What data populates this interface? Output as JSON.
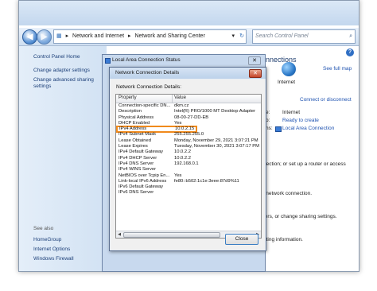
{
  "explorer": {
    "breadcrumb": [
      "Network and Internet",
      "Network and Sharing Center"
    ],
    "search_placeholder": "Search Control Panel",
    "sep": "▸"
  },
  "sidebar": {
    "home": "Control Panel Home",
    "items": [
      "Change adapter settings",
      "Change advanced sharing settings"
    ],
    "see_also": "See also",
    "see_also_items": [
      "HomeGroup",
      "Internet Options",
      "Windows Firewall"
    ]
  },
  "main": {
    "connections_heading": "onnections",
    "see_full_map": "See full map",
    "internet": "Internet",
    "connect_or_disconnect": "Connect or disconnect",
    "access_type_label": "e:",
    "access_type_value": "Internet",
    "homegroup_label": "p:",
    "homegroup_value": "Ready to create",
    "connections_label": "ns:",
    "connections_value": "Local Area Connection",
    "setup_text": "nection; or set up a router or access",
    "network_text": "l network connection.",
    "sharing_text": "ters, or change sharing settings.",
    "options_text": "oting information."
  },
  "status_dialog": {
    "title": "Local Area Connection Status"
  },
  "details_dialog": {
    "title": "Network Connection Details",
    "label": "Network Connection Details:",
    "col_property": "Property",
    "col_value": "Value",
    "rows": [
      {
        "p": "Connection-specific DN...",
        "v": "dkm.cz"
      },
      {
        "p": "Description",
        "v": "Intel(R) PRO/1000 MT Desktop Adapter"
      },
      {
        "p": "Physical Address",
        "v": "08-00-27-DD-EB"
      },
      {
        "p": "DHCP Enabled",
        "v": "Yes"
      },
      {
        "p": "IPv4 Address",
        "v": "10.0.2.15"
      },
      {
        "p": "IPv4 Subnet Mask",
        "v": "255.255.255.0"
      },
      {
        "p": "Lease Obtained",
        "v": "Monday, November 29, 2021 3:07:21 PM"
      },
      {
        "p": "Lease Expires",
        "v": "Tuesday, November 30, 2021 3:07:17 PM"
      },
      {
        "p": "IPv4 Default Gateway",
        "v": "10.0.2.2"
      },
      {
        "p": "IPv4 DHCP Server",
        "v": "10.0.2.2"
      },
      {
        "p": "IPv4 DNS Server",
        "v": "192.168.0.1"
      },
      {
        "p": "IPv4 WINS Server",
        "v": ""
      },
      {
        "p": "NetBIOS over Tcpip En...",
        "v": "Yes"
      },
      {
        "p": "Link-local IPv6 Address",
        "v": "fe80::b502:1c1e:3eee:87d9%11"
      },
      {
        "p": "IPv6 Default Gateway",
        "v": ""
      },
      {
        "p": "IPv6 DNS Server",
        "v": ""
      }
    ],
    "highlight_row": 4,
    "highlight_color": "#f08a1c",
    "close_label": "Close"
  }
}
